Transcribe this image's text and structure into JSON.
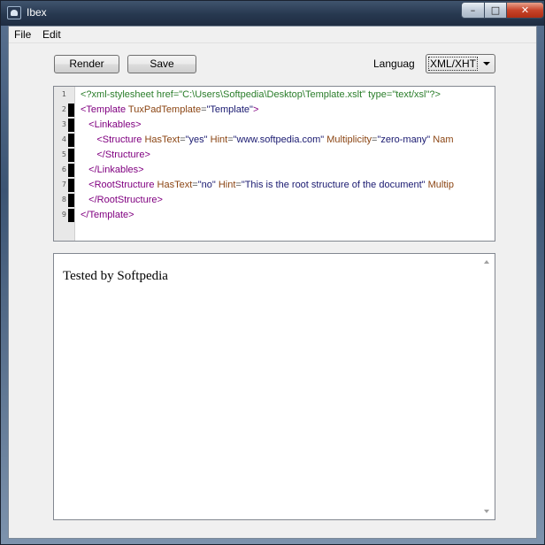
{
  "window": {
    "title": "Ibex"
  },
  "controls": {
    "minimize": "–",
    "maximize": "□",
    "close": "✕"
  },
  "menu": {
    "file": "File",
    "edit": "Edit"
  },
  "toolbar": {
    "render_label": "Render",
    "save_label": "Save",
    "language_label": "Languag",
    "language_value": "XML/XHTML"
  },
  "editor": {
    "line_numbers": [
      "1",
      "2",
      "3",
      "4",
      "5",
      "6",
      "7",
      "8",
      "9"
    ],
    "lines": [
      {
        "indent": "",
        "parts": [
          [
            "pi",
            "<?xml-stylesheet href=\"C:\\Users\\Softpedia\\Desktop\\Template.xslt\" type=\"text/xsl\"?>"
          ]
        ]
      },
      {
        "indent": "",
        "parts": [
          [
            "tag",
            "<Template "
          ],
          [
            "attr",
            "TuxPadTemplate"
          ],
          [
            "eq",
            "="
          ],
          [
            "val",
            "\"Template\""
          ],
          [
            "tag",
            ">"
          ]
        ]
      },
      {
        "indent": "   ",
        "parts": [
          [
            "tag",
            "<Linkables>"
          ]
        ]
      },
      {
        "indent": "      ",
        "parts": [
          [
            "tag",
            "<Structure "
          ],
          [
            "attr",
            "HasText"
          ],
          [
            "eq",
            "="
          ],
          [
            "val",
            "\"yes\" "
          ],
          [
            "attr",
            "Hint"
          ],
          [
            "eq",
            "="
          ],
          [
            "val",
            "\"www.softpedia.com\" "
          ],
          [
            "attr",
            "Multiplicity"
          ],
          [
            "eq",
            "="
          ],
          [
            "val",
            "\"zero-many\" "
          ],
          [
            "attr",
            "Nam"
          ]
        ]
      },
      {
        "indent": "      ",
        "parts": [
          [
            "tag",
            "</Structure>"
          ]
        ]
      },
      {
        "indent": "   ",
        "parts": [
          [
            "tag",
            "</Linkables>"
          ]
        ]
      },
      {
        "indent": "   ",
        "parts": [
          [
            "tag",
            "<RootStructure "
          ],
          [
            "attr",
            "HasText"
          ],
          [
            "eq",
            "="
          ],
          [
            "val",
            "\"no\" "
          ],
          [
            "attr",
            "Hint"
          ],
          [
            "eq",
            "="
          ],
          [
            "val",
            "\"This is the root structure of the document\" "
          ],
          [
            "attr",
            "Multip"
          ]
        ]
      },
      {
        "indent": "   ",
        "parts": [
          [
            "tag",
            "</RootStructure>"
          ]
        ]
      },
      {
        "indent": "",
        "parts": [
          [
            "tag",
            "</Template>"
          ]
        ]
      }
    ]
  },
  "preview": {
    "text": "Tested by Softpedia"
  },
  "colors": {
    "pi": "#2a7d2a",
    "tag": "#800080",
    "attr": "#8b4513",
    "val": "#191970",
    "eq": "#555555"
  }
}
